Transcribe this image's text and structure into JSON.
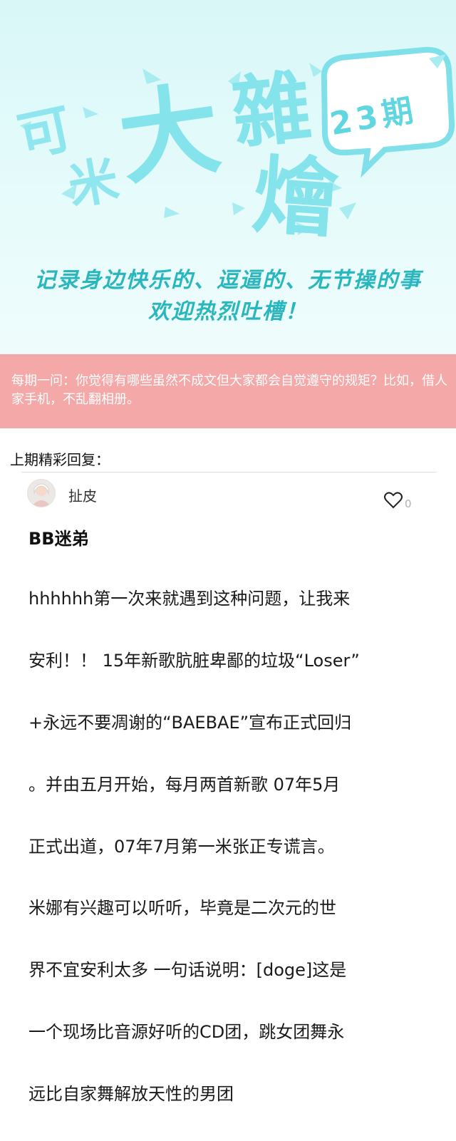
{
  "banner": {
    "issue_label": "23期",
    "title_chars": [
      "可",
      "米",
      "大",
      "雜",
      "燴"
    ],
    "tagline_line1": "记录身边快乐的、逗逼的、无节操的事",
    "tagline_line2": "欢迎热烈吐槽！",
    "colors": {
      "background": "#dff8f8",
      "title": "#85e3ec",
      "tagline": "#2ab6bd",
      "bubble_text": "#60d7e0"
    }
  },
  "question_bar": {
    "text": "每期一问：你觉得有哪些虽然不成文但大家都会自觉遵守的规矩？比如，借人家手机，不乱翻相册。",
    "color": "#f4a8a8"
  },
  "previous_label": "上期精彩回复：",
  "reply": {
    "user_name": "扯皮",
    "like_count": "0",
    "like_icon": "heart-outline-icon",
    "title": "BB迷弟",
    "body_lines": [
      "hhhhhh第一次来就遇到这种问题，让我来",
      "安利！！ 15年新歌肮脏卑鄙的垃圾“Loser”",
      "+永远不要凋谢的“BAEBAE”宣布正式回归",
      "。并由五月开始，每月两首新歌 07年5月",
      "正式出道，07年7月第一米张正专谎言。",
      "米娜有兴趣可以听听，毕竟是二次元的世",
      "界不宜安利太多 一句话说明：[doge]这是",
      "一个现场比音源好听的CD团，跳女团舞永",
      "远比自家舞解放天性的男团"
    ]
  }
}
